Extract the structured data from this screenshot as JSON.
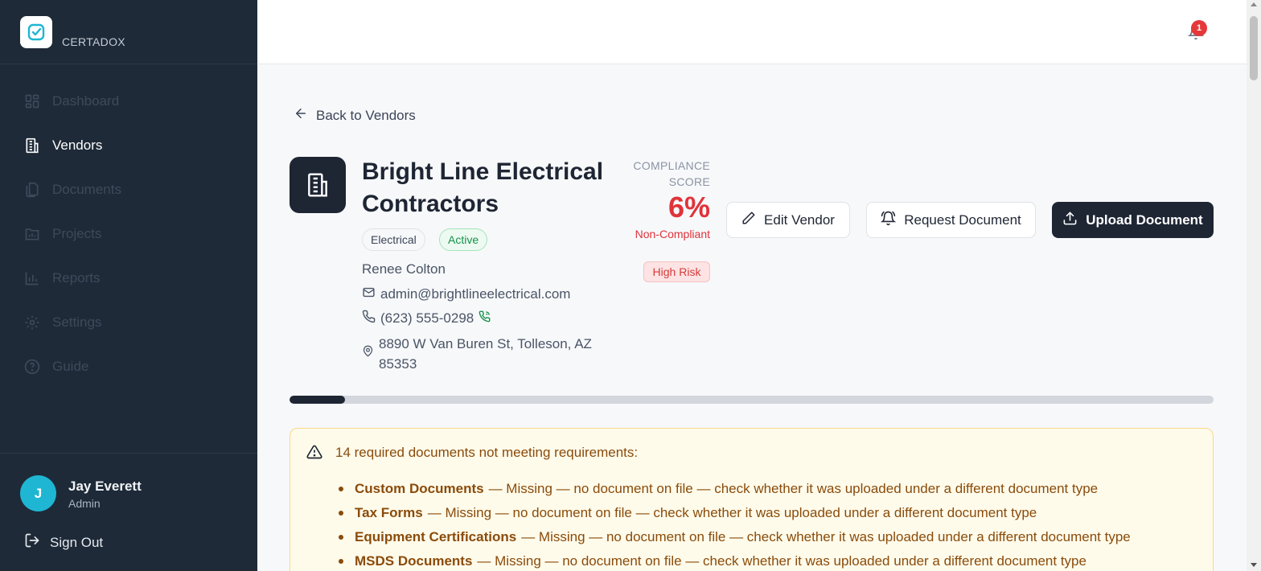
{
  "brand": {
    "name": "CERTADOX"
  },
  "sidebar": {
    "items": [
      {
        "label": "Dashboard",
        "icon": "dashboard-icon"
      },
      {
        "label": "Vendors",
        "icon": "building-icon"
      },
      {
        "label": "Documents",
        "icon": "documents-icon"
      },
      {
        "label": "Projects",
        "icon": "folder-chart-icon"
      },
      {
        "label": "Reports",
        "icon": "bar-chart-icon"
      },
      {
        "label": "Settings",
        "icon": "gear-icon"
      },
      {
        "label": "Guide",
        "icon": "help-circle-icon"
      }
    ],
    "active": "Vendors"
  },
  "user": {
    "initial": "J",
    "name": "Jay Everett",
    "role": "Admin",
    "signout_label": "Sign Out"
  },
  "topbar": {
    "notification_count": "1"
  },
  "back_link": "Back to Vendors",
  "vendor": {
    "name": "Bright Line Electrical Contractors",
    "category": "Electrical",
    "status": "Active",
    "contact_name": "Renee Colton",
    "email": "admin@brightlineelectrical.com",
    "phone": "(623) 555-0298",
    "address": "8890 W Van Buren St, Tolleson, AZ 85353"
  },
  "compliance": {
    "label": "COMPLIANCE SCORE",
    "score": "6%",
    "score_fraction": 0.06,
    "status": "Non-Compliant",
    "risk": "High Risk"
  },
  "actions": {
    "edit": "Edit Vendor",
    "request": "Request Document",
    "upload": "Upload Document"
  },
  "alert": {
    "title": "14 required documents not meeting requirements:",
    "items": [
      {
        "doc": "Custom Documents",
        "detail": "— Missing — no document on file — check whether it was uploaded under a different document type"
      },
      {
        "doc": "Tax Forms",
        "detail": "— Missing — no document on file — check whether it was uploaded under a different document type"
      },
      {
        "doc": "Equipment Certifications",
        "detail": "— Missing — no document on file — check whether it was uploaded under a different document type"
      },
      {
        "doc": "MSDS Documents",
        "detail": "— Missing — no document on file — check whether it was uploaded under a different document type"
      }
    ]
  },
  "colors": {
    "sidebar_bg": "#1e2a38",
    "danger": "#e0333a",
    "success": "#17914a",
    "warning_text": "#8a4b0a",
    "accent_cyan": "#1fb6d3"
  }
}
